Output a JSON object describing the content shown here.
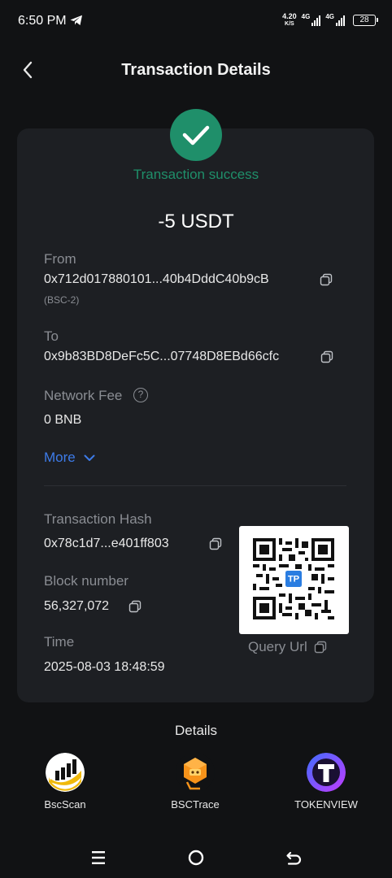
{
  "status_bar": {
    "time": "6:50 PM",
    "speed_value": "4.20",
    "speed_unit": "K/S",
    "network1": "4G",
    "network2": "4G",
    "battery": "28"
  },
  "header": {
    "title": "Transaction Details",
    "back_icon": "chevron-left-icon"
  },
  "transaction": {
    "status_text": "Transaction success",
    "status_color": "#1f8f6a",
    "amount": "-5 USDT",
    "from_label": "From",
    "from_address": "0x712d017880101...40b4DddC40b9cB",
    "from_network": "(BSC-2)",
    "to_label": "To",
    "to_address": "0x9b83BD8DeFc5C...07748D8EBd66cfc",
    "fee_label": "Network Fee",
    "fee_value": "0 BNB",
    "more_label": "More",
    "hash_label": "Transaction Hash",
    "hash_value": "0x78c1d7...e401ff803",
    "block_label": "Block number",
    "block_value": "56,327,072",
    "time_label": "Time",
    "time_value": "2025-08-03 18:48:59",
    "qr_badge": "TP",
    "query_url_label": "Query Url"
  },
  "details": {
    "title": "Details",
    "explorers": [
      {
        "name": "BscScan"
      },
      {
        "name": "BSCTrace"
      },
      {
        "name": "TOKENVIEW"
      }
    ]
  },
  "colors": {
    "background": "#111214",
    "card": "#1d1f23",
    "accent_blue": "#3d7be8",
    "success_green": "#1f8f6a"
  }
}
